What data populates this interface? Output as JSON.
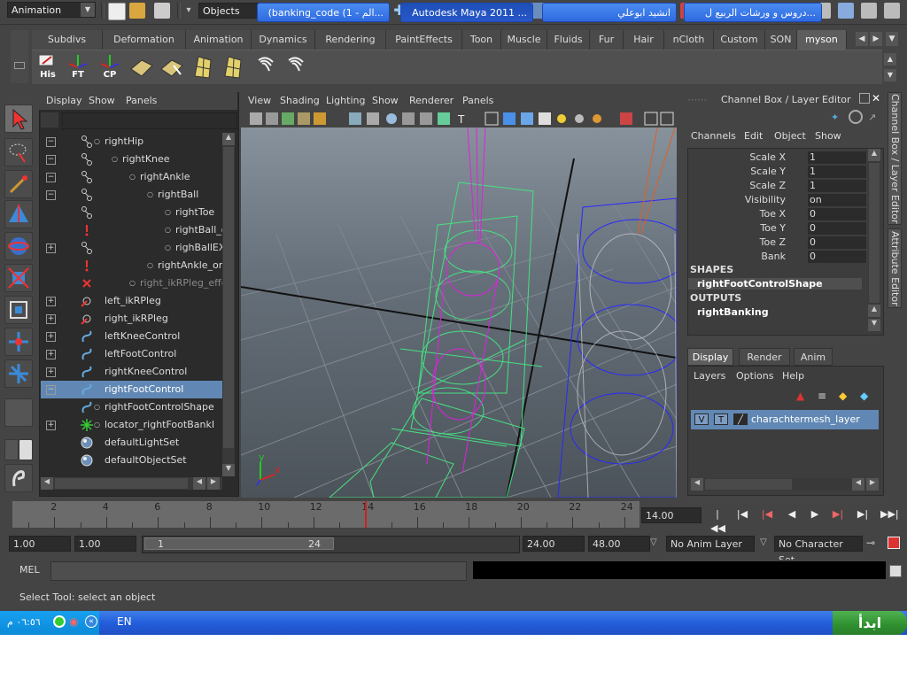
{
  "toolbar": {
    "mode": "Animation",
    "objects": "Objects"
  },
  "shelf": {
    "tabs": [
      "Subdivs",
      "Deformation",
      "Animation",
      "Dynamics",
      "Rendering",
      "PaintEffects",
      "Toon",
      "Muscle",
      "Fluids",
      "Fur",
      "Hair",
      "nCloth",
      "Custom",
      "SON",
      "myson"
    ],
    "active_tab": "myson",
    "icons": [
      {
        "label": "His",
        "icon": "history-icon"
      },
      {
        "label": "FT",
        "icon": "freeze-transform-icon"
      },
      {
        "label": "CP",
        "icon": "center-pivot-icon"
      }
    ]
  },
  "outliner": {
    "menu": [
      "Display",
      "Show",
      "Panels"
    ],
    "items": [
      {
        "label": "rightHip",
        "indent": 0,
        "expand": "-",
        "icon": "joint"
      },
      {
        "label": "rightKnee",
        "indent": 1,
        "expand": "-",
        "icon": "joint"
      },
      {
        "label": "rightAnkle",
        "indent": 2,
        "expand": "-",
        "icon": "joint"
      },
      {
        "label": "rightBall",
        "indent": 3,
        "expand": "-",
        "icon": "joint"
      },
      {
        "label": "rightToe",
        "indent": 4,
        "expand": "",
        "icon": "joint"
      },
      {
        "label": "rightBall_o",
        "indent": 4,
        "expand": "",
        "icon": "constraint"
      },
      {
        "label": "righBallEX",
        "indent": 4,
        "expand": "+",
        "icon": "joint"
      },
      {
        "label": "rightAnkle_orie",
        "indent": 3,
        "expand": "",
        "icon": "constraint"
      },
      {
        "label": "right_ikRPleg_effe",
        "indent": 2,
        "expand": "",
        "icon": "effector"
      },
      {
        "label": "left_ikRPleg",
        "indent": -1,
        "expand": "+",
        "icon": "ikhandle"
      },
      {
        "label": "right_ikRPleg",
        "indent": -1,
        "expand": "+",
        "icon": "ikhandle"
      },
      {
        "label": "leftKneeControl",
        "indent": -1,
        "expand": "+",
        "icon": "curve"
      },
      {
        "label": "leftFootControl",
        "indent": -1,
        "expand": "+",
        "icon": "curve"
      },
      {
        "label": "rightKneeControl",
        "indent": -1,
        "expand": "+",
        "icon": "curve"
      },
      {
        "label": "rightFootControl",
        "indent": -1,
        "expand": "-",
        "icon": "curve",
        "selected": true
      },
      {
        "label": "rightFootControlShape",
        "indent": 0,
        "expand": "",
        "icon": "curve"
      },
      {
        "label": "locator_rightFootBankI",
        "indent": 0,
        "expand": "+",
        "icon": "locator"
      },
      {
        "label": "defaultLightSet",
        "indent": -1,
        "expand": "",
        "icon": "set"
      },
      {
        "label": "defaultObjectSet",
        "indent": -1,
        "expand": "",
        "icon": "set"
      }
    ]
  },
  "viewport": {
    "menu": [
      "View",
      "Shading",
      "Lighting",
      "Show",
      "Renderer",
      "Panels"
    ],
    "axis_x": "x",
    "axis_y": "y"
  },
  "channel_box": {
    "title": "Channel Box / Layer Editor",
    "menu": [
      "Channels",
      "Edit",
      "Object",
      "Show"
    ],
    "attributes": [
      {
        "name": "Scale X",
        "value": "1"
      },
      {
        "name": "Scale Y",
        "value": "1"
      },
      {
        "name": "Scale Z",
        "value": "1"
      },
      {
        "name": "Visibility",
        "value": "on"
      },
      {
        "name": "Toe X",
        "value": "0"
      },
      {
        "name": "Toe Y",
        "value": "0"
      },
      {
        "name": "Toe Z",
        "value": "0"
      },
      {
        "name": "Bank",
        "value": "0"
      }
    ],
    "shapes_heading": "SHAPES",
    "shape_name": "rightFootControlShape",
    "outputs_heading": "OUTPUTS",
    "output_name": "rightBanking",
    "side_tabs": [
      "Channel Box / Layer Editor",
      "Attribute Editor"
    ]
  },
  "layer_editor": {
    "tabs": [
      "Display",
      "Render",
      "Anim"
    ],
    "active_tab": "Display",
    "menu": [
      "Layers",
      "Options",
      "Help"
    ],
    "layer": {
      "v": "V",
      "t": "T",
      "name": "charachtermesh_layer"
    }
  },
  "time_slider": {
    "ticks": [
      "2",
      "4",
      "6",
      "8",
      "10",
      "12",
      "14",
      "16",
      "18",
      "20",
      "22",
      "24"
    ],
    "current_frame": "14.00"
  },
  "range_slider": {
    "start": "1.00",
    "start_field2": "1.00",
    "handle_start": "1",
    "handle_end": "24",
    "end": "24.00",
    "anim_end": "48.00",
    "anim_layer": "No Anim Layer",
    "character_set": "No Character Set"
  },
  "command_line": {
    "label": "MEL"
  },
  "help_line": "Select Tool: select an object",
  "taskbar": {
    "start": "ابدأ",
    "buttons": [
      {
        "label": "دروس و ورشات الربيع ل...",
        "active": false
      },
      {
        "label": "انشيد ابوعلي",
        "active": false
      },
      {
        "label": "Autodesk Maya 2011 ...",
        "active": true
      },
      {
        "label": "(banking_code (1 - الم...",
        "active": false
      }
    ],
    "language": "EN",
    "clock": "٠٦:٥٦ م"
  }
}
